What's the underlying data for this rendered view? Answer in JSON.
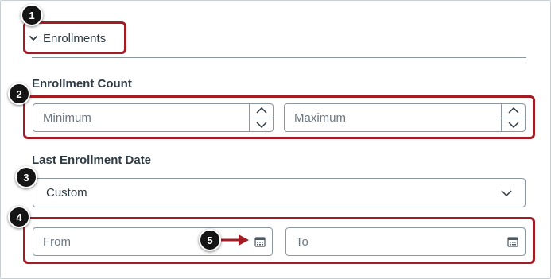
{
  "section": {
    "toggle_label": "Enrollments",
    "toggle_icon": "chevron-down-icon"
  },
  "enrollment_count": {
    "heading": "Enrollment Count",
    "minimum_placeholder": "Minimum",
    "maximum_placeholder": "Maximum"
  },
  "last_enrollment_date": {
    "heading": "Last Enrollment Date",
    "selected_option": "Custom",
    "from_placeholder": "From",
    "to_placeholder": "To"
  },
  "callouts": [
    "1",
    "2",
    "3",
    "4",
    "5"
  ],
  "colors": {
    "callout_border": "#a31c24",
    "callout_badge": "#151515",
    "text": "#2d3b45",
    "input_border": "#8b969e"
  }
}
